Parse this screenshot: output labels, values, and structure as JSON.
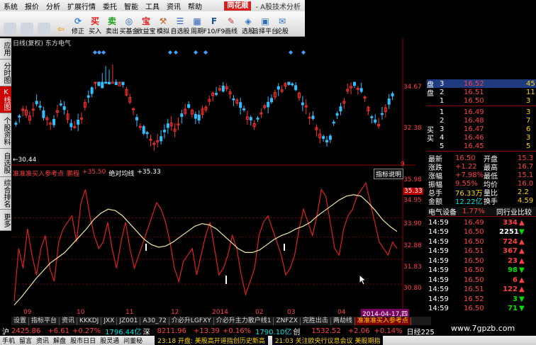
{
  "menu": {
    "items": [
      "系统",
      "报价",
      "分析",
      "扩展行情",
      "委托",
      "智能",
      "工具",
      "资讯",
      "帮助"
    ],
    "brand": "同花顺",
    "subtitle": "- A股技术分析"
  },
  "toolbar": {
    "buttons": [
      {
        "label": "",
        "icon": "blank-icon"
      },
      {
        "label": "",
        "icon": "blank-icon"
      },
      {
        "label": "",
        "icon": "blank-icon"
      },
      {
        "label": "",
        "icon": "back-arrow-icon"
      },
      {
        "label": "修正",
        "icon": "refresh-icon"
      },
      {
        "label": "买入",
        "icon": "buy-icon"
      },
      {
        "label": "卖出",
        "icon": "sell-icon"
      },
      {
        "label": "买基金",
        "icon": "fund-icon"
      },
      {
        "label": "收益宝",
        "icon": "treasure-icon"
      },
      {
        "label": "模拟",
        "icon": "hammer-icon"
      },
      {
        "label": "自选股",
        "icon": "star-list-icon"
      },
      {
        "label": "周期",
        "icon": "period-icon"
      },
      {
        "label": "F10/F9",
        "icon": "f10-icon"
      },
      {
        "label": "画线",
        "icon": "pen-icon"
      },
      {
        "label": "选股",
        "icon": "select-icon"
      },
      {
        "label": "旨择平台",
        "icon": "platform-icon"
      },
      {
        "label": "论股",
        "icon": "forum-icon"
      }
    ]
  },
  "left_tabs": [
    "应用",
    "分时图",
    "K线图",
    "个股资料",
    "自选股",
    "综合排名",
    "更多"
  ],
  "chart": {
    "header": "日线(复权) 东方电气",
    "price_ticks": [
      "34.67",
      "32.38"
    ],
    "low_label": "←30.44",
    "indicator_name": "准准准买入参考点",
    "indicator_sub": "鹏程",
    "indicator_value_label": "+35.50",
    "avg_label": "绝对均线",
    "avg_value": "+35.33",
    "indicator_button": "指标说明",
    "ind_ticks": [
      "35.98",
      "35.33",
      "34.95",
      "33.90",
      "32.88",
      "31.83",
      "30.80"
    ],
    "x_labels": [
      "09",
      "10",
      "11",
      "12",
      "2014",
      "02",
      "03",
      "04"
    ],
    "date_label": "2014-04-17,四",
    "marker_top": "9"
  },
  "quote": {
    "sell_label": "盘",
    "asks": [
      {
        "lvl": "3",
        "price": "16.52",
        "vol": "45"
      },
      {
        "lvl": "2",
        "price": "16.51",
        "vol": "11"
      },
      {
        "lvl": "1",
        "price": "16.50",
        "vol": "3"
      }
    ],
    "buy_label": "买",
    "bids": [
      {
        "lvl": "1",
        "price": "16.49",
        "vol": "3"
      },
      {
        "lvl": "2",
        "price": "16.48",
        "vol": "7"
      },
      {
        "lvl": "3",
        "price": "16.47",
        "vol": "6"
      },
      {
        "lvl": "4",
        "price": "16.46",
        "vol": "3"
      },
      {
        "lvl": "5",
        "price": "16.45",
        "vol": "5"
      }
    ],
    "stats": [
      {
        "l1": "最新",
        "v1": "16.50",
        "l2": "开盘",
        "v2": "15.3"
      },
      {
        "l1": "涨跌",
        "v1": "+1.22",
        "l2": "最高",
        "v2": "16.7"
      },
      {
        "l1": "涨幅",
        "v1": "+7.98%",
        "l2": "最低",
        "v2": "15.1"
      },
      {
        "l1": "振幅",
        "v1": "9.55%",
        "l2": "均价",
        "v2": "16.0"
      },
      {
        "l1": "总手",
        "v1": "76.33万",
        "l2": "量比",
        "v2": "2.2"
      },
      {
        "l1": "金额",
        "v1": "12.22亿",
        "l2": "换手",
        "v2": "4.59"
      }
    ],
    "sector_name": "电气设备",
    "sector_change": "1.77%",
    "sector_link": "同行业比较",
    "ticks": [
      {
        "time": "14:59",
        "price": "16.49",
        "vol": "334",
        "dir": "down"
      },
      {
        "time": "14:59",
        "price": "16.50",
        "vol": "2251",
        "dir": "up"
      },
      {
        "time": "14:59",
        "price": "16.50",
        "vol": "724",
        "dir": "down"
      },
      {
        "time": "14:59",
        "price": "16.51",
        "vol": "367",
        "dir": "down"
      },
      {
        "time": "14:59",
        "price": "16.50",
        "vol": "23",
        "dir": "down"
      },
      {
        "time": "14:59",
        "price": "16.50",
        "vol": "98",
        "dir": "up"
      },
      {
        "time": "14:59",
        "price": "16.50",
        "vol": "6",
        "dir": "down"
      },
      {
        "time": "14:59",
        "price": "16.51",
        "vol": "122",
        "dir": "down"
      },
      {
        "time": "14:59",
        "price": "16.52",
        "vol": "3",
        "dir": "up"
      },
      {
        "time": "14:59",
        "price": "16.50",
        "vol": "71",
        "dir": "up"
      }
    ]
  },
  "bottom_tabs": [
    "设置",
    "指标平台",
    "资讯",
    "KKKDJ",
    "JXX",
    "JZ001",
    "A30_72",
    "介必升LGFXY",
    "介必升主力散户线1",
    "ZNFZX",
    "完胜出击",
    "两劫线",
    "准准准买入参考点"
  ],
  "status": {
    "sh_label": "沪",
    "sh_index": "2425.86",
    "sh_change": "+6.61",
    "sh_pct": "+0.27%",
    "sh_amount": "1796.44亿",
    "sz_label": "深",
    "sz_index": "8211.96",
    "sz_change": "+13.39",
    "sz_pct": "+0.16%",
    "sz_amount": "1790.10亿",
    "cy_label": "创",
    "cy_index": "1532.52",
    "cy_change": "+2.06",
    "cy_pct": "+0.14%",
    "cy_amount": "",
    "rz_label": "日经225"
  },
  "statusbar": {
    "items": [
      "手机",
      "留言",
      "资讯",
      "解盘",
      "股市日日",
      "股灵通",
      "问董秘"
    ],
    "news1": "23:18 开盘: 美股高开道指创历史新高",
    "news2": "21:03 关注欧央行议息会议 美股期指"
  },
  "watermark": "www.7gpzb.com",
  "colors": {
    "up": "#ff4040",
    "down": "#00e000",
    "avg": "#f0e6a0",
    "kline_up": "#ff3030",
    "kline_down": "#30c0ff"
  }
}
